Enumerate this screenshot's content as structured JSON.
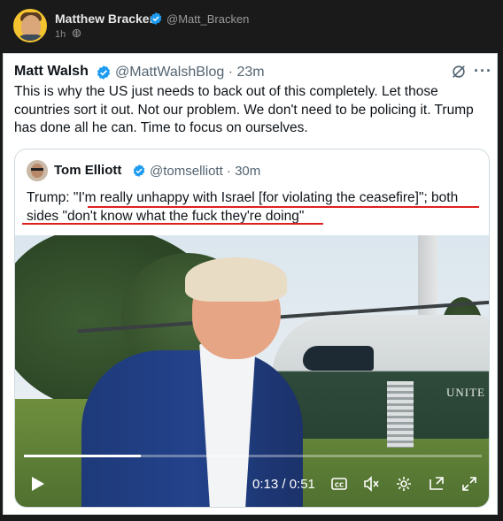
{
  "outer_post": {
    "author_name": "Matthew Bracken",
    "author_handle": "@Matt_Bracken",
    "time": "1h",
    "visibility_icon": "globe-icon"
  },
  "tweet": {
    "author_name": "Matt Walsh",
    "author_handle": "@MattWalshBlog · 23m",
    "text": "This is why the US just needs to back out of this completely. Let those countries sort it out. Not our problem. We don't need to be policing it. Trump has done all he can. Time to focus on ourselves."
  },
  "quoted_tweet": {
    "author_name": "Tom Elliott",
    "author_handle": "@tomselliott · 30m",
    "text": "Trump: \"I'm really unhappy with Israel [for violating the ceasefire]\"; both sides \"don't know what the fuck they're doing\"",
    "highlight_color": "#e02020"
  },
  "video": {
    "current_time": "0:13",
    "duration": "0:51",
    "time_display": "0:13 / 0:51",
    "progress": 0.255,
    "aircraft_label": "UNITE"
  },
  "icons": {
    "verified": "verified-badge-icon",
    "grok": "grok-icon",
    "more": "more-icon",
    "play": "play-icon",
    "captions": "captions-icon",
    "mute": "mute-icon",
    "settings": "gear-icon",
    "pip": "pip-icon",
    "fullscreen": "fullscreen-icon"
  },
  "colors": {
    "verified_blue": "#1d9bf0",
    "text_primary": "#0f1419",
    "text_secondary": "#536471"
  }
}
